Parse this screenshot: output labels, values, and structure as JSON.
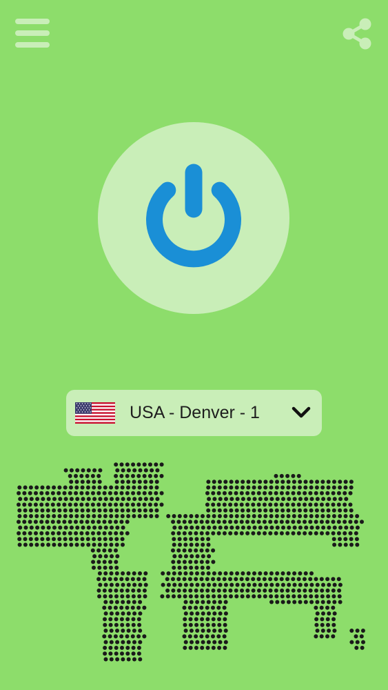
{
  "colors": {
    "background": "#8DDD6B",
    "panel": "#C9EEB8",
    "power_icon": "#1A8FD6",
    "top_icons": "#C9EEB8",
    "map_dots": "#1A1A1A"
  },
  "header": {
    "menu_icon": "hamburger-menu-icon",
    "share_icon": "share-icon"
  },
  "connect": {
    "icon": "power-icon"
  },
  "server": {
    "label": "USA - Denver - 1",
    "flag_icon": "us-flag-icon",
    "dropdown_icon": "chevron-down-icon"
  },
  "map": {
    "icon": "dotted-world-map"
  }
}
